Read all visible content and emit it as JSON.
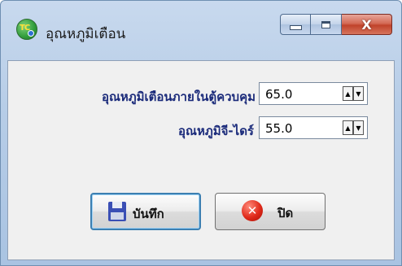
{
  "window": {
    "title": "อุณหภูมิเตือน",
    "controls": {
      "minimize_icon": "minimize-icon",
      "maximize_icon": "maximize-icon",
      "close_icon": "close-icon",
      "close_glyph": "X"
    },
    "app_icon_text": "TC"
  },
  "form": {
    "fields": [
      {
        "label": "อุณหภูมิเตือนภายในตู้ควบคุม",
        "value": "65.0"
      },
      {
        "label": "อุณหภูมิจี-ไดร์",
        "value": "55.0"
      }
    ],
    "spin_up": "▲",
    "spin_down": "▼"
  },
  "buttons": {
    "save_label": "บันทึก",
    "close_label": "ปิด",
    "close_glyph": "✕"
  },
  "colors": {
    "label_text": "#1a2a7a",
    "close_button": "#c0432b",
    "focus_border": "#3c7fb1"
  }
}
